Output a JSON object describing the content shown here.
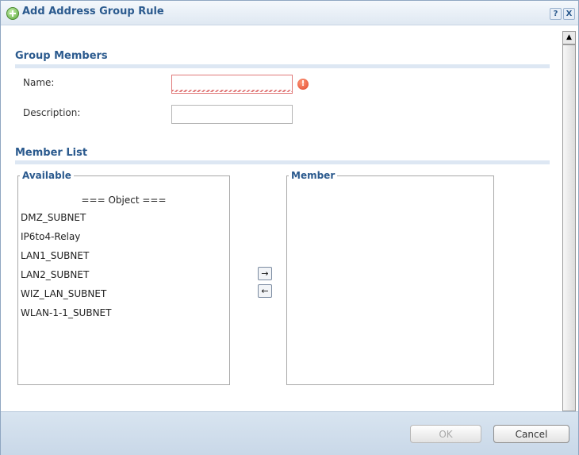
{
  "dialog": {
    "title": "Add Address Group Rule",
    "help_icon": "?",
    "close_icon": "X"
  },
  "group_members": {
    "section_title": "Group Members",
    "name_label": "Name:",
    "name_value": "",
    "description_label": "Description:",
    "description_value": "",
    "error_icon": "!"
  },
  "member_list": {
    "section_title": "Member List",
    "available": {
      "legend": "Available",
      "header": "=== Object ===",
      "items": [
        "DMZ_SUBNET",
        "IP6to4-Relay",
        "LAN1_SUBNET",
        "LAN2_SUBNET",
        "WIZ_LAN_SUBNET",
        "WLAN-1-1_SUBNET"
      ]
    },
    "member": {
      "legend": "Member",
      "items": []
    },
    "add_arrow": "→",
    "remove_arrow": "←"
  },
  "footer": {
    "ok_label": "OK",
    "cancel_label": "Cancel"
  },
  "scrollbar": {
    "up": "▲",
    "down": "▼"
  },
  "colors": {
    "accent": "#2b5a8e",
    "error": "#e0452b"
  }
}
